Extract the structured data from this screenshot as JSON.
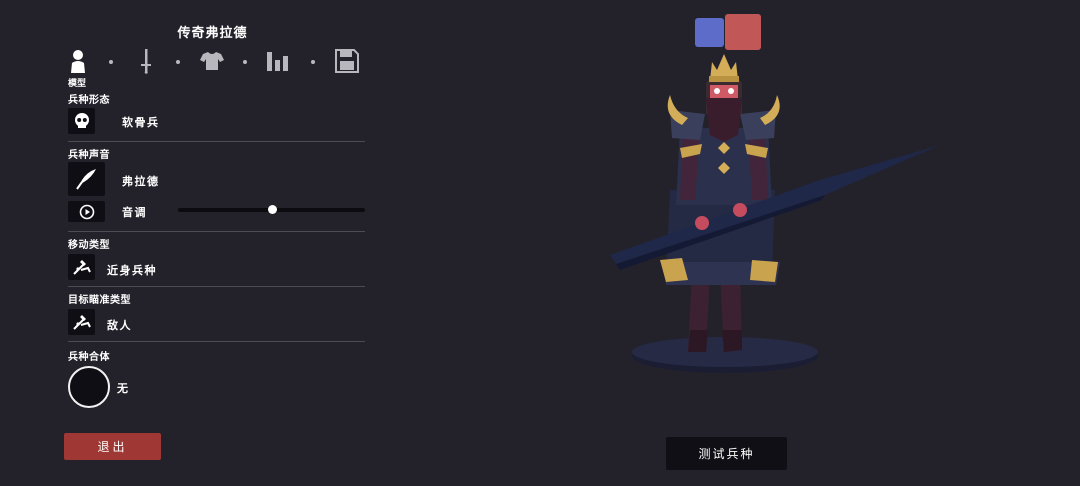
{
  "header": {
    "title": "传奇弗拉德"
  },
  "tabs": [
    {
      "icon": "person-icon",
      "caption": "模型"
    },
    {
      "icon": "sword-icon"
    },
    {
      "icon": "shirt-icon"
    },
    {
      "icon": "stats-icon"
    },
    {
      "icon": "save-icon"
    }
  ],
  "sections": {
    "form": {
      "label": "兵种形态",
      "value": "软骨兵",
      "icon": "skull-icon"
    },
    "voice": {
      "label": "兵种声音",
      "value": "弗拉德",
      "icon": "quill-icon",
      "pitch_label": "音调",
      "pitch_value": 0.5
    },
    "movement": {
      "label": "移动类型",
      "value": "近身兵种",
      "icon": "melee-icon"
    },
    "targeting": {
      "label": "目标瞄准类型",
      "value": "敌人",
      "icon": "target-icon"
    },
    "fusion": {
      "label": "兵种合体",
      "value": "无"
    }
  },
  "buttons": {
    "exit": "退出",
    "test": "测试兵种"
  },
  "colors": {
    "team_blue": "#5d6cc9",
    "team_red": "#c25757",
    "exit_bg": "#9f3735"
  }
}
